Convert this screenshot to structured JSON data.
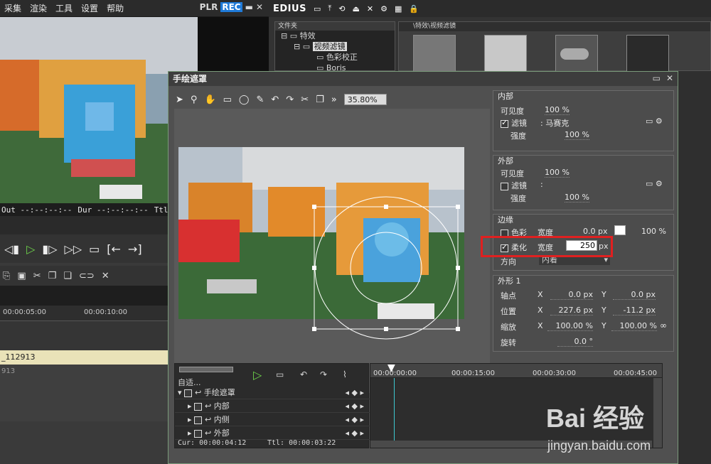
{
  "menu": {
    "items": [
      "采集",
      "渲染",
      "工具",
      "设置",
      "帮助"
    ],
    "plr": "PLR",
    "rec": "REC"
  },
  "timecodes": {
    "out": "Out --:--:--:--",
    "dur": "Dur --:--:--:--",
    "ttl": "Ttl"
  },
  "timeline": {
    "t1": "00:00:05:00",
    "t2": "00:00:10:00",
    "clip": "_112913",
    "track": "913"
  },
  "edius": {
    "logo": "EDIUS"
  },
  "tree": {
    "header": "文件夹",
    "items": [
      "特效",
      "视频滤镜",
      "色彩校正",
      "Boris"
    ]
  },
  "thumbs": {
    "path": "\\特效\\视频滤镜"
  },
  "dialog": {
    "title": "手绘遮罩",
    "zoom": "35.80%",
    "inner": {
      "title": "内部",
      "visibility_label": "可见度",
      "visibility_value": "100 %",
      "filter_label": "滤镜",
      "filter_value": ": 马赛克",
      "strength_label": "强度",
      "strength_value": "100 %"
    },
    "outer": {
      "title": "外部",
      "visibility_label": "可见度",
      "visibility_value": "100 %",
      "filter_label": "滤镜",
      "filter_value": ":",
      "strength_label": "强度",
      "strength_value": "100 %"
    },
    "edge": {
      "title": "边缘",
      "color_label": "色彩",
      "width_label": "宽度",
      "color_width_value": "0.0 px",
      "opacity_value": "100 %",
      "soft_label": "柔化",
      "soft_width_label": "宽度",
      "soft_width_value": "250",
      "px": "px",
      "direction_label": "方向",
      "direction_value": "内着"
    },
    "shape": {
      "title": "外形 1",
      "anchor_label": "轴点",
      "pos_label": "位置",
      "scale_label": "缩放",
      "rot_label": "旋转",
      "x": "X",
      "y": "Y",
      "anchor_x": "0.0 px",
      "anchor_y": "0.0 px",
      "pos_x": "227.6 px",
      "pos_y": "-11.2 px",
      "scale_x": "100.00 %",
      "scale_y": "100.00 %",
      "rot": "0.0 °"
    }
  },
  "bottom": {
    "auto": "自适...",
    "rows": [
      "手绘遮罩",
      "内部",
      "内侧",
      "外部"
    ],
    "cur": "Cur: 00:00:04:12",
    "ttl": "Ttl: 00:00:03:22",
    "ticks": [
      "00:00:00:00",
      "00:00:15:00",
      "00:00:30:00",
      "00:00:45:00"
    ]
  },
  "watermark": {
    "brand": "Bai 经验",
    "url": "jingyan.baidu.com"
  }
}
